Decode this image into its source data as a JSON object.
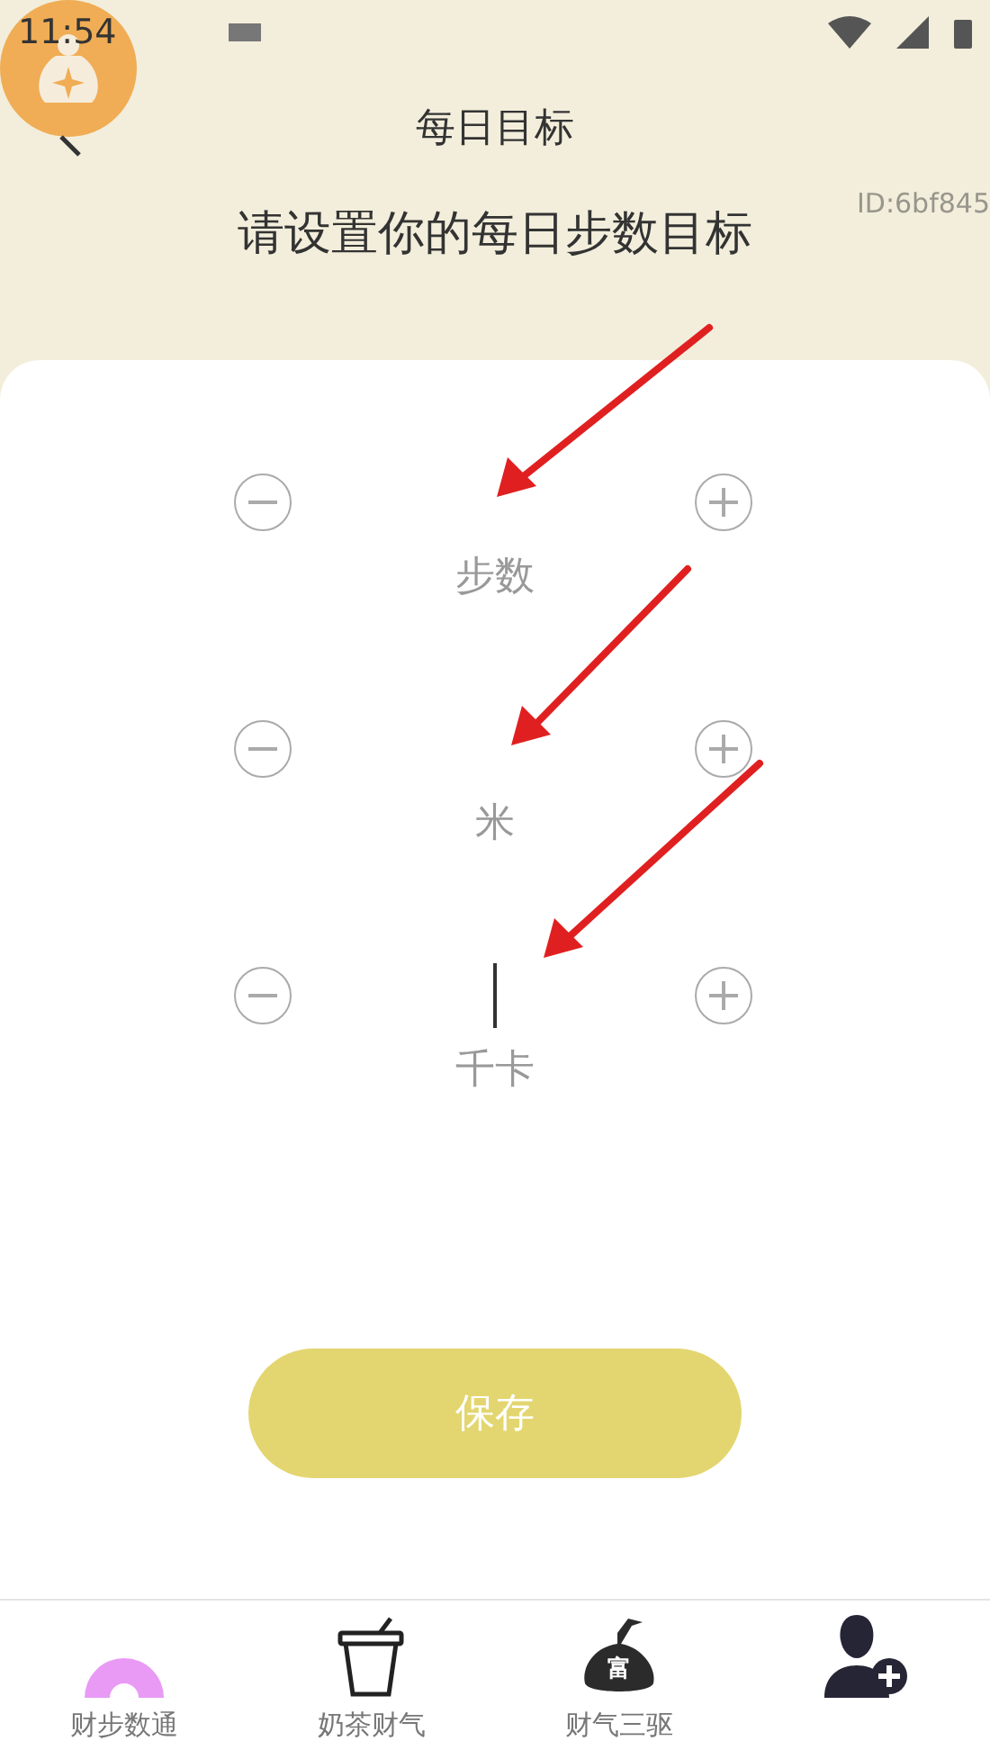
{
  "status_bar": {
    "time": "11:54"
  },
  "header": {
    "title": "每日目标",
    "id_label": "ID:6bf845",
    "subtitle": "请设置你的每日步数目标"
  },
  "goals": [
    {
      "label": "步数",
      "focused": false
    },
    {
      "label": "米",
      "focused": false
    },
    {
      "label": "千卡",
      "focused": true
    }
  ],
  "save_button": {
    "label": "保存",
    "disabled": true
  },
  "bottom_nav": [
    {
      "kind": "arch",
      "label": "财步数通"
    },
    {
      "kind": "cup",
      "label": "奶茶财气"
    },
    {
      "kind": "bag",
      "label": "财气三驱",
      "icon_text": "富"
    },
    {
      "kind": "person"
    }
  ]
}
